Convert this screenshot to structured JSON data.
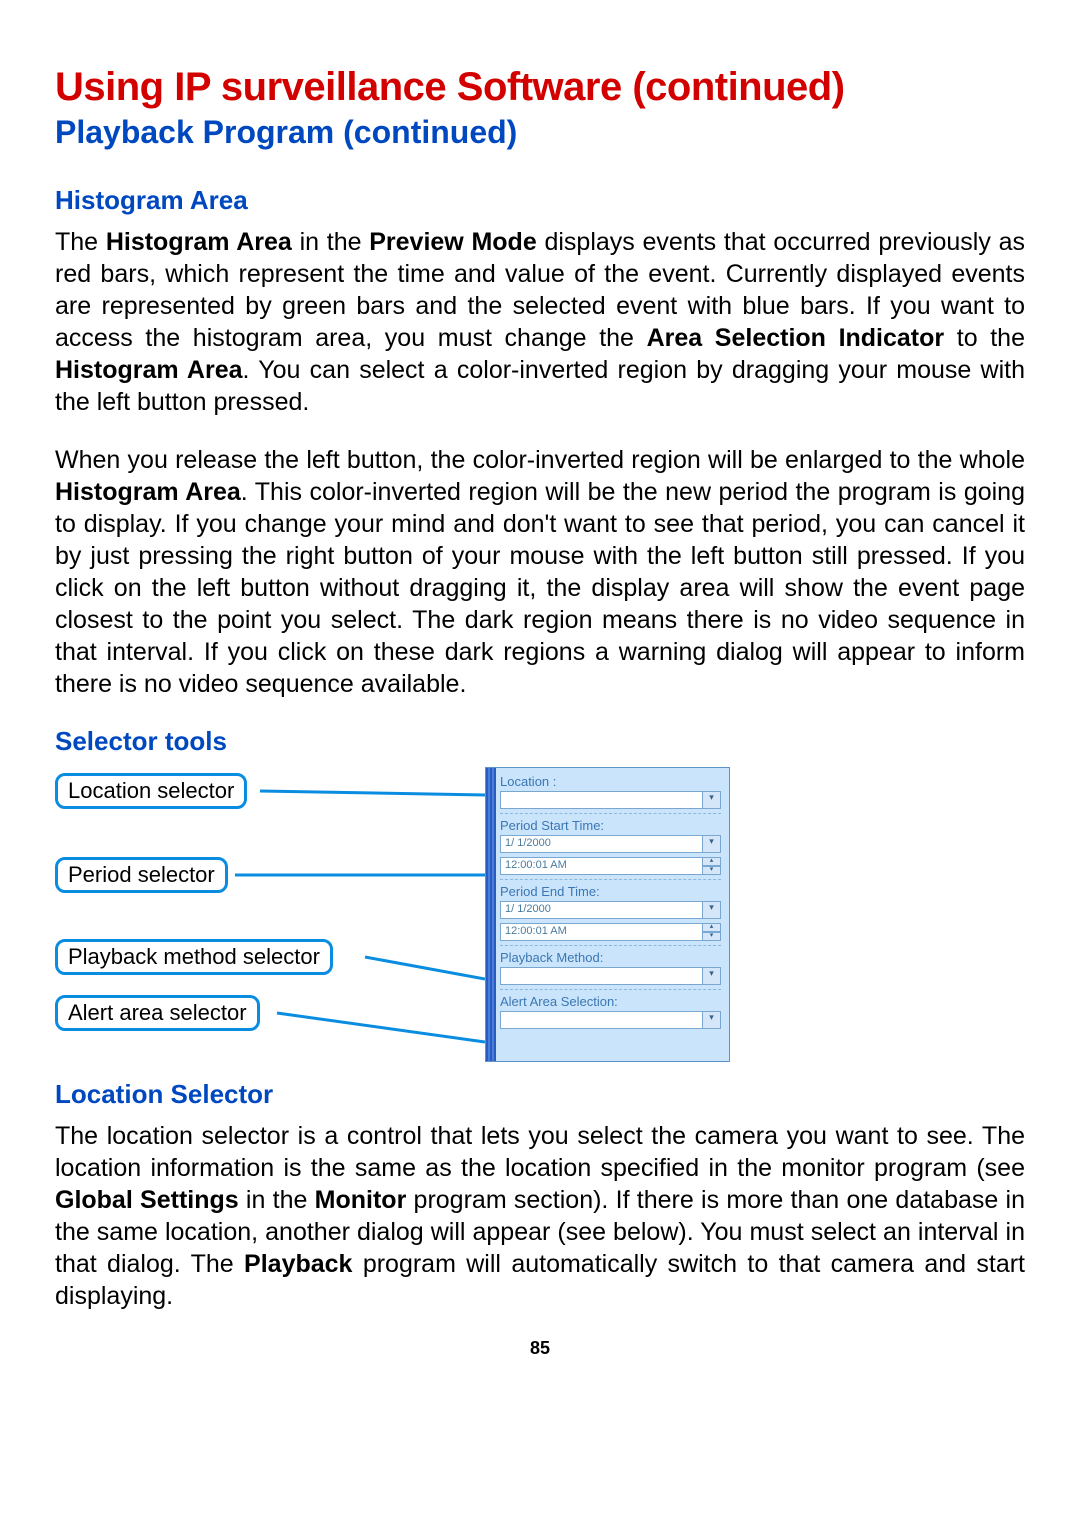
{
  "title_main": "Using IP surveillance Software (continued)",
  "title_sub": "Playback Program (continued)",
  "histogram": {
    "heading": "Histogram Area",
    "p1_a": "The ",
    "p1_b": "Histogram Area",
    "p1_c": " in the ",
    "p1_d": "Preview Mode",
    "p1_e": " displays events that occurred previously as red bars, which represent the time and value of the event. Currently displayed events are represented by green bars and the selected event with blue bars. If you want to access the histogram area, you must change the ",
    "p1_f": "Area Selection Indicator",
    "p1_g": " to the ",
    "p1_h": "Histogram Area",
    "p1_i": ". You can select a color-inverted region by dragging your mouse with the left button pressed.",
    "p2_a": "When you release the left button, the color-inverted region will be enlarged to the whole ",
    "p2_b": "Histogram Area",
    "p2_c": ". This color-inverted region will be the new period the program is going to display. If you change your mind and don't want to see that period, you can cancel it by just pressing the right button of your mouse with the left button  still pressed. If you click on the left button without dragging it, the display area will show the event page closest to the point you select. The dark region means there is no video sequence in that interval. If you click on these dark regions a warning dialog will appear to inform there is no video sequence available."
  },
  "selector": {
    "heading": "Selector tools",
    "labels": {
      "location": "Location selector",
      "period": "Period selector",
      "playback": "Playback method selector",
      "alert": "Alert area selector"
    },
    "panel": {
      "location_label": "Location :",
      "location_value": "",
      "period_start_label": "Period Start Time:",
      "period_start_date": "1/ 1/2000",
      "period_start_time": "12:00:01 AM",
      "period_end_label": "Period End Time:",
      "period_end_date": "1/ 1/2000",
      "period_end_time": "12:00:01 AM",
      "playback_label": "Playback Method:",
      "playback_value": "",
      "alert_label": "Alert Area Selection:",
      "alert_value": ""
    }
  },
  "location_selector": {
    "heading": "Location Selector",
    "p_a": "The location selector is a control that lets you select the camera you want to see. The location information is the same as the location specified in the monitor program (see ",
    "p_b": "Global Settings",
    "p_c": " in the ",
    "p_d": "Monitor",
    "p_e": " program section). If there is more than one database in the same location, another dialog will appear (see below). You must select an interval in that dialog. The ",
    "p_f": "Playback",
    "p_g": " program will automatically switch to that camera and start displaying."
  },
  "page_number": "85"
}
